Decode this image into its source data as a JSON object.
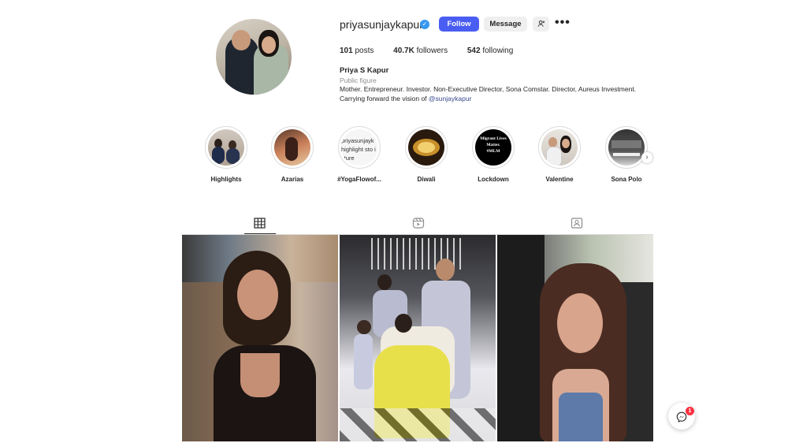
{
  "profile": {
    "username": "priyasunjaykapur",
    "verified_icon": "verified-badge-icon",
    "follow_label": "Follow",
    "message_label": "Message",
    "posts_count": "101",
    "posts_label": "posts",
    "followers_count": "40.7K",
    "followers_label": "followers",
    "following_count": "542",
    "following_label": "following",
    "full_name": "Priya S Kapur",
    "category": "Public figure",
    "bio_line1": "Mother. Entrepreneur. Investor. Non-Executive Director, Sona Comstar. Director, Aureus Investment.",
    "bio_line2_prefix": "Carrying forward the vision of ",
    "bio_mention": "@sunjaykapur"
  },
  "highlights": [
    {
      "label": "Highlights"
    },
    {
      "label": "Azarias"
    },
    {
      "label": "#YogaFlowof...",
      "thumb_text": "priyasunjayk highlight sto icture"
    },
    {
      "label": "Diwali"
    },
    {
      "label": "Lockdown",
      "thumb_text": "Migrant Lives Matter. #MLM"
    },
    {
      "label": "Valentine"
    },
    {
      "label": "Sona Polo"
    }
  ],
  "tabs": [
    "posts-grid",
    "reels",
    "tagged"
  ],
  "notification_count": "1",
  "colors": {
    "accent": "#4a5df2",
    "verified": "#3897f0",
    "mention": "#384b8f",
    "badge": "#ff3040"
  }
}
